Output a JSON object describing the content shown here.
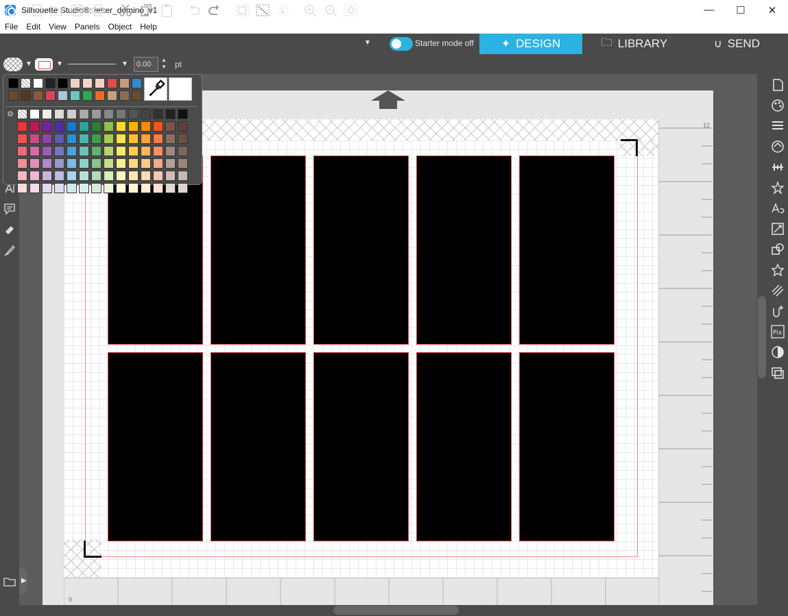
{
  "window": {
    "title": "Silhouette Studio®: letter_domino_v1",
    "minimize": "—",
    "maximize": "☐",
    "close": "✕"
  },
  "menu": [
    "File",
    "Edit",
    "View",
    "Panels",
    "Object",
    "Help"
  ],
  "toolbar": {
    "starter_mode_label": "Starter mode off",
    "tabs": [
      {
        "label": "DESIGN",
        "icon": "design-icon",
        "active": true
      },
      {
        "label": "LIBRARY",
        "icon": "folder-icon",
        "active": false
      },
      {
        "label": "SEND",
        "icon": "send-icon",
        "active": false
      }
    ],
    "accent_color": "#2bb3e0"
  },
  "line_options": {
    "width_value": "0.00",
    "unit": "pt"
  },
  "ruler": {
    "right_top_label": "12",
    "bottom_left_label": "9"
  },
  "palette": {
    "top_rows": [
      [
        "#000000",
        "transparent",
        "#ffffff",
        "#222222",
        "#000000",
        "#f3d0c4",
        "#f2d7c9",
        "#f3d2c3",
        "#e24b4b",
        "#c79c7a",
        "#2e8bd0"
      ],
      [
        "#6b4a2a",
        "#5c3420",
        "#8a5a36",
        "#e0425d",
        "#a7c7dd",
        "#6cc7bb",
        "#2aa952",
        "#ef6a2a",
        "#c7a07c",
        "#8a6e58",
        "#6a4a2e"
      ]
    ],
    "grid_rows": [
      [
        "transparent",
        "#ffffff",
        "#eeeeee",
        "#dddddd",
        "#cccccc",
        "#aaaaaa",
        "#999999",
        "#888888",
        "#777777",
        "#555555",
        "#444444",
        "#333333",
        "#222222",
        "#111111"
      ],
      [
        "#e53935",
        "#c2185b",
        "#7b1fa2",
        "#512da8",
        "#1976d2",
        "#26a69a",
        "#2e7d32",
        "#8bc34a",
        "#fdd835",
        "#ffb300",
        "#fb8c00",
        "#f4511e",
        "#795548",
        "#5d4037"
      ],
      [
        "#ef5350",
        "#d04a8a",
        "#8e44ad",
        "#5e5bb0",
        "#2b8fd6",
        "#4db6ac",
        "#3fa04a",
        "#a7cc52",
        "#fbe34a",
        "#ffc12a",
        "#fba33a",
        "#f57c48",
        "#8d6e63",
        "#6d5043"
      ],
      [
        "#f06a78",
        "#d86aa2",
        "#9b5bbb",
        "#7777c0",
        "#4aa3dc",
        "#6cc3b9",
        "#5bb56b",
        "#b9d56a",
        "#fbe86a",
        "#ffcc55",
        "#fbb560",
        "#f68f68",
        "#a1887f",
        "#7f6459"
      ],
      [
        "#f48d9a",
        "#e38dba",
        "#b18ac9",
        "#9a9ad0",
        "#7cbbe4",
        "#8fd0c8",
        "#86c58e",
        "#c8df8a",
        "#fcef90",
        "#ffd980",
        "#fcc88a",
        "#f8a98a",
        "#b5a09a",
        "#9a867e"
      ],
      [
        "#f7b6c0",
        "#eeb6d2",
        "#cbb3dc",
        "#bdbde2",
        "#a9d2ef",
        "#b6e1db",
        "#b3dbb8",
        "#dcecb6",
        "#fdf5bb",
        "#ffe7b0",
        "#fddcb6",
        "#fac7b3",
        "#cdbdb8",
        "#c4b8b3"
      ],
      [
        "#fadadf",
        "#f6d8e7",
        "#e4d6ec",
        "#dcdcef",
        "#d2e7f6",
        "#d6eeea",
        "#d6ecd8",
        "#ecf5d8",
        "#fefadc",
        "#fff3d6",
        "#feecd8",
        "#fce0d6",
        "#e2d8d4",
        "#dcd6d3"
      ]
    ]
  },
  "cards": {
    "count": 10,
    "fill": "#000000",
    "stroke": "#d94040"
  },
  "icons": {
    "left_tools": [
      "text-icon",
      "text-box-icon",
      "eraser-icon",
      "knife-icon",
      "folder-icon"
    ],
    "right_panel": [
      "page-setup-icon",
      "fill-palette-icon",
      "line-style-icon",
      "fill-pattern-icon",
      "align-icon",
      "trace-icon",
      "text-style-icon",
      "transform-icon",
      "shapes-icon",
      "favorites-icon",
      "sketch-icon",
      "send-to-icon",
      "pixscan-icon",
      "offset-icon",
      "replicate-icon"
    ]
  }
}
